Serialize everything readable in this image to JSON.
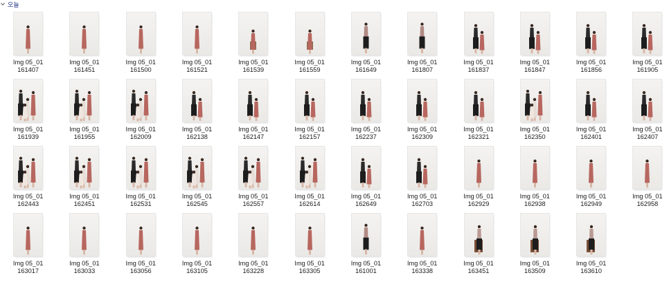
{
  "group": {
    "label": "오늘",
    "icon": "chevron-down-icon"
  },
  "files": [
    {
      "line1": "Img 05_01",
      "line2": "161407",
      "pose": "single"
    },
    {
      "line1": "Img 05_01",
      "line2": "161451",
      "pose": "single"
    },
    {
      "line1": "Img 05_01",
      "line2": "161500",
      "pose": "single"
    },
    {
      "line1": "Img 05_01",
      "line2": "161521",
      "pose": "single"
    },
    {
      "line1": "Img 05_01",
      "line2": "161539",
      "pose": "seated"
    },
    {
      "line1": "Img 05_01",
      "line2": "161559",
      "pose": "seated"
    },
    {
      "line1": "Img 05_01",
      "line2": "161649",
      "pose": "dark"
    },
    {
      "line1": "Img 05_01",
      "line2": "161807",
      "pose": "dark"
    },
    {
      "line1": "Img 05_01",
      "line2": "161837",
      "pose": "pair"
    },
    {
      "line1": "Img 05_01",
      "line2": "161847",
      "pose": "pair"
    },
    {
      "line1": "Img 05_01",
      "line2": "161856",
      "pose": "pair"
    },
    {
      "line1": "Img 05_01",
      "line2": "161905",
      "pose": "pair"
    },
    {
      "line1": "Img 05_01",
      "line2": "161939",
      "pose": "group"
    },
    {
      "line1": "Img 05_01",
      "line2": "161955",
      "pose": "group"
    },
    {
      "line1": "Img 05_01",
      "line2": "162009",
      "pose": "group"
    },
    {
      "line1": "Img 05_01",
      "line2": "162138",
      "pose": "pair"
    },
    {
      "line1": "Img 05_01",
      "line2": "162147",
      "pose": "pair"
    },
    {
      "line1": "Img 05_01",
      "line2": "162157",
      "pose": "pair"
    },
    {
      "line1": "Img 05_01",
      "line2": "162237",
      "pose": "pair"
    },
    {
      "line1": "Img 05_01",
      "line2": "162309",
      "pose": "pair"
    },
    {
      "line1": "Img 05_01",
      "line2": "162321",
      "pose": "pair"
    },
    {
      "line1": "Img 05_01",
      "line2": "162350",
      "pose": "group"
    },
    {
      "line1": "Img 05_01",
      "line2": "162401",
      "pose": "pair"
    },
    {
      "line1": "Img 05_01",
      "line2": "162407",
      "pose": "pair"
    },
    {
      "line1": "Img 05_01",
      "line2": "162443",
      "pose": "group"
    },
    {
      "line1": "Img 05_01",
      "line2": "162451",
      "pose": "group"
    },
    {
      "line1": "Img 05_01",
      "line2": "162531",
      "pose": "group"
    },
    {
      "line1": "Img 05_01",
      "line2": "162545",
      "pose": "group"
    },
    {
      "line1": "Img 05_01",
      "line2": "162557",
      "pose": "group"
    },
    {
      "line1": "Img 05_01",
      "line2": "162614",
      "pose": "group"
    },
    {
      "line1": "Img 05_01",
      "line2": "162649",
      "pose": "pair"
    },
    {
      "line1": "Img 05_01",
      "line2": "162703",
      "pose": "pair"
    },
    {
      "line1": "Img 05_01",
      "line2": "162929",
      "pose": "single"
    },
    {
      "line1": "Img 05_01",
      "line2": "162938",
      "pose": "single"
    },
    {
      "line1": "Img 05_01",
      "line2": "162949",
      "pose": "single"
    },
    {
      "line1": "Img 05_01",
      "line2": "162958",
      "pose": "single"
    },
    {
      "line1": "Img 05_01",
      "line2": "163017",
      "pose": "single"
    },
    {
      "line1": "Img 05_01",
      "line2": "163033",
      "pose": "single"
    },
    {
      "line1": "Img 05_01",
      "line2": "163056",
      "pose": "single"
    },
    {
      "line1": "Img 05_01",
      "line2": "163105",
      "pose": "single"
    },
    {
      "line1": "Img 05_01",
      "line2": "163228",
      "pose": "single"
    },
    {
      "line1": "Img 05_01",
      "line2": "163305",
      "pose": "single"
    },
    {
      "line1": "Img 05_01",
      "line2": "161001",
      "pose": "dark"
    },
    {
      "line1": "Img 05_01",
      "line2": "163338",
      "pose": "single"
    },
    {
      "line1": "Img 05_01",
      "line2": "163451",
      "pose": "man"
    },
    {
      "line1": "Img 05_01",
      "line2": "163509",
      "pose": "man"
    },
    {
      "line1": "Img 05_01",
      "line2": "163610",
      "pose": "man"
    }
  ]
}
